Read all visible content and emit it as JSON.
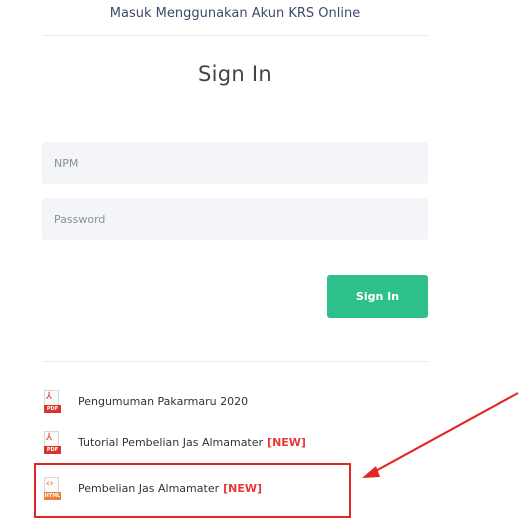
{
  "header": {
    "login_with": "Masuk Menggunakan Akun KRS Online"
  },
  "form": {
    "title": "Sign In",
    "npm_placeholder": "NPM",
    "password_placeholder": "Password",
    "submit_label": "Sign In"
  },
  "files": [
    {
      "label": "Pengumuman Pakarmaru 2020",
      "badge": "",
      "type": "PDF",
      "icon": "pdf-file-icon"
    },
    {
      "label": "Tutorial Pembelian Jas Almamater",
      "badge": "[NEW]",
      "type": "PDF",
      "icon": "pdf-file-icon"
    },
    {
      "label": "Pembelian Jas Almamater",
      "badge": "[NEW]",
      "type": "HTML",
      "icon": "html-file-icon"
    }
  ],
  "colors": {
    "accent": "#2ec08a",
    "annotation": "#e22424",
    "new_badge": "#e53935"
  }
}
